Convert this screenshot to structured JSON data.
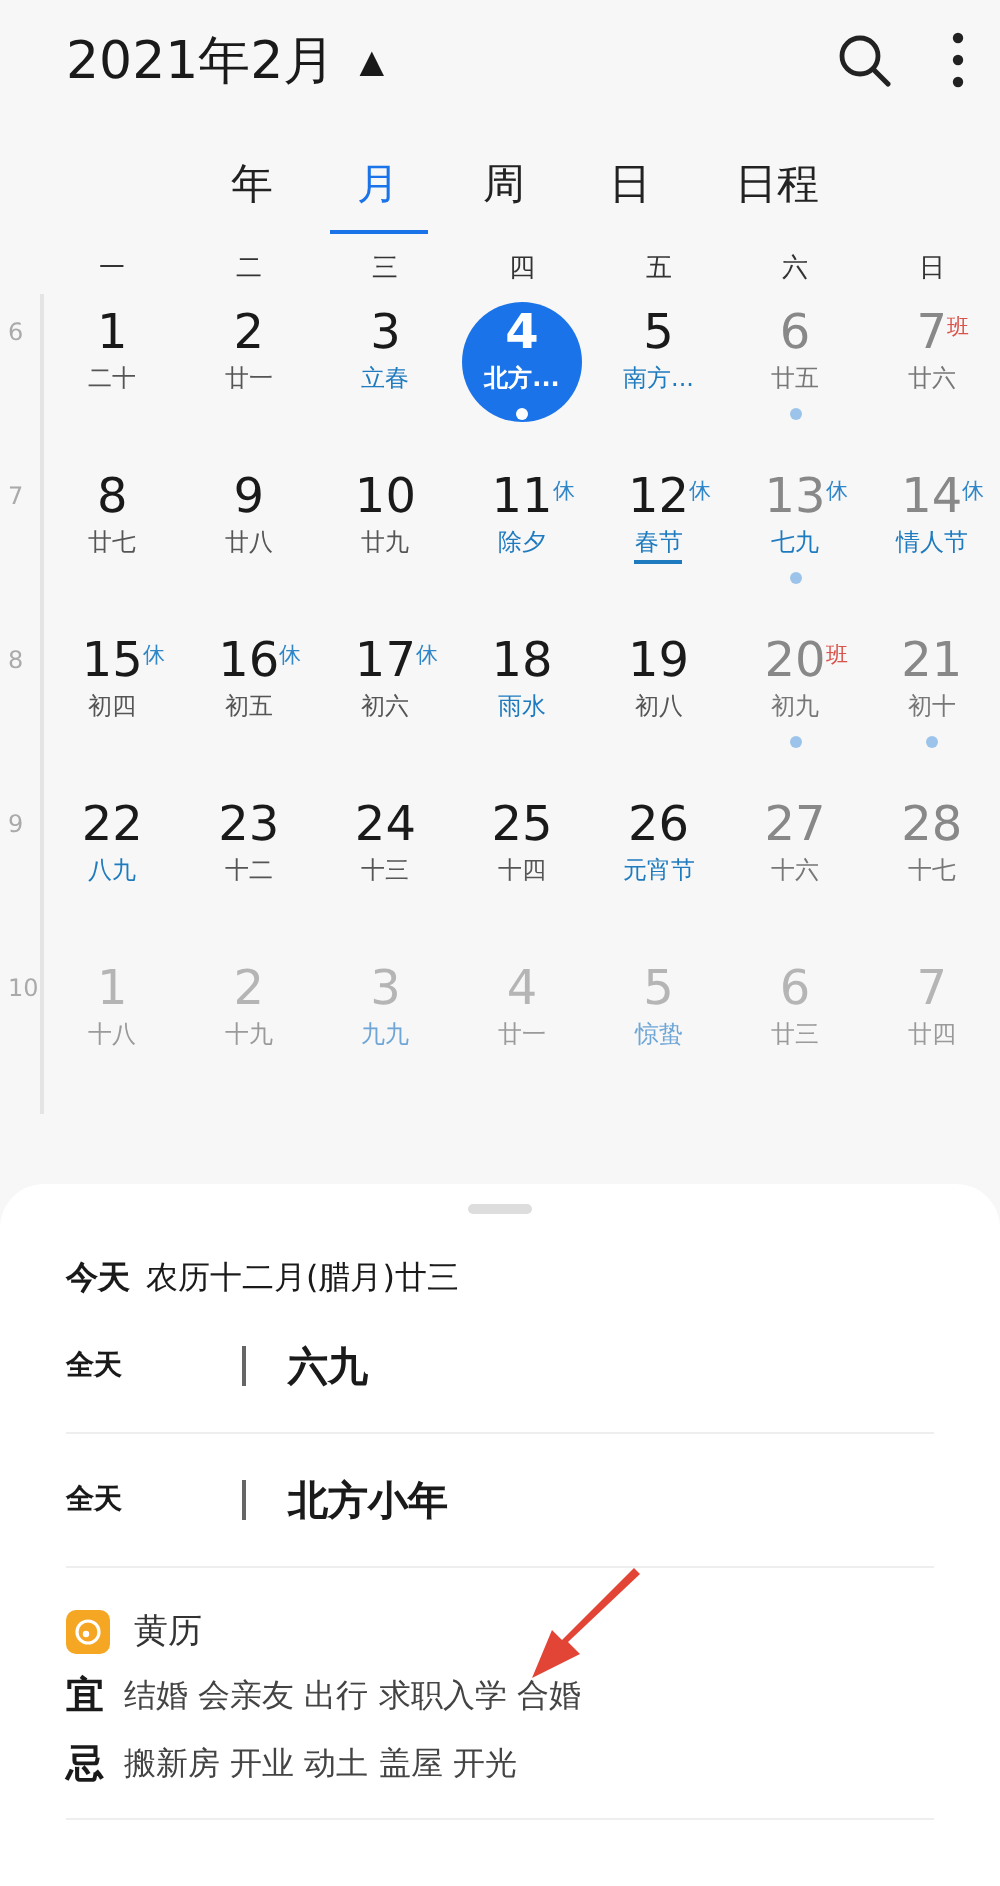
{
  "header": {
    "title": "2021年2月",
    "caret": "▲"
  },
  "view_tabs": [
    {
      "label": "年",
      "selected": false
    },
    {
      "label": "月",
      "selected": true
    },
    {
      "label": "周",
      "selected": false
    },
    {
      "label": "日",
      "selected": false
    },
    {
      "label": "日程",
      "selected": false
    }
  ],
  "weekdays": [
    "一",
    "二",
    "三",
    "四",
    "五",
    "六",
    "日"
  ],
  "weeks": [
    {
      "number": "6",
      "days": [
        {
          "day": "1",
          "lunar": "二十",
          "festival": false,
          "weekend": false,
          "other_month": false,
          "dot": false,
          "selected": false,
          "underlined": false
        },
        {
          "day": "2",
          "lunar": "廿一",
          "festival": false,
          "weekend": false,
          "other_month": false,
          "dot": false,
          "selected": false,
          "underlined": false
        },
        {
          "day": "3",
          "lunar": "立春",
          "festival": true,
          "weekend": false,
          "other_month": false,
          "dot": false,
          "selected": false,
          "underlined": false
        },
        {
          "day": "4",
          "lunar": "北方...",
          "festival": true,
          "weekend": false,
          "other_month": false,
          "dot": true,
          "selected": true,
          "underlined": false
        },
        {
          "day": "5",
          "lunar": "南方...",
          "festival": true,
          "weekend": false,
          "other_month": false,
          "dot": false,
          "selected": false,
          "underlined": false
        },
        {
          "day": "6",
          "lunar": "廿五",
          "festival": false,
          "weekend": true,
          "other_month": false,
          "dot": true,
          "selected": false,
          "underlined": false
        },
        {
          "day": "7",
          "lunar": "廿六",
          "festival": false,
          "weekend": true,
          "other_month": false,
          "dot": false,
          "selected": false,
          "underlined": false,
          "tag": {
            "text": "班",
            "color": "#d9534a"
          }
        }
      ]
    },
    {
      "number": "7",
      "days": [
        {
          "day": "8",
          "lunar": "廿七",
          "festival": false,
          "weekend": false,
          "other_month": false,
          "dot": false,
          "selected": false,
          "underlined": false
        },
        {
          "day": "9",
          "lunar": "廿八",
          "festival": false,
          "weekend": false,
          "other_month": false,
          "dot": false,
          "selected": false,
          "underlined": false
        },
        {
          "day": "10",
          "lunar": "廿九",
          "festival": false,
          "weekend": false,
          "other_month": false,
          "dot": false,
          "selected": false,
          "underlined": false
        },
        {
          "day": "11",
          "lunar": "除夕",
          "festival": true,
          "weekend": false,
          "other_month": false,
          "dot": false,
          "selected": false,
          "underlined": false,
          "tag": {
            "text": "休",
            "color": "#2f86c8"
          }
        },
        {
          "day": "12",
          "lunar": "春节",
          "festival": true,
          "weekend": false,
          "other_month": false,
          "dot": false,
          "selected": false,
          "underlined": true,
          "tag": {
            "text": "休",
            "color": "#2f86c8"
          }
        },
        {
          "day": "13",
          "lunar": "七九",
          "festival": true,
          "weekend": true,
          "other_month": false,
          "dot": true,
          "selected": false,
          "underlined": false,
          "tag": {
            "text": "休",
            "color": "#2f86c8"
          }
        },
        {
          "day": "14",
          "lunar": "情人节",
          "festival": true,
          "weekend": true,
          "other_month": false,
          "dot": false,
          "selected": false,
          "underlined": false,
          "tag": {
            "text": "休",
            "color": "#2f86c8"
          }
        }
      ]
    },
    {
      "number": "8",
      "days": [
        {
          "day": "15",
          "lunar": "初四",
          "festival": false,
          "weekend": false,
          "other_month": false,
          "dot": false,
          "selected": false,
          "underlined": false,
          "tag": {
            "text": "休",
            "color": "#2f86c8"
          }
        },
        {
          "day": "16",
          "lunar": "初五",
          "festival": false,
          "weekend": false,
          "other_month": false,
          "dot": false,
          "selected": false,
          "underlined": false,
          "tag": {
            "text": "休",
            "color": "#2f86c8"
          }
        },
        {
          "day": "17",
          "lunar": "初六",
          "festival": false,
          "weekend": false,
          "other_month": false,
          "dot": false,
          "selected": false,
          "underlined": false,
          "tag": {
            "text": "休",
            "color": "#2f86c8"
          }
        },
        {
          "day": "18",
          "lunar": "雨水",
          "festival": true,
          "weekend": false,
          "other_month": false,
          "dot": false,
          "selected": false,
          "underlined": false
        },
        {
          "day": "19",
          "lunar": "初八",
          "festival": false,
          "weekend": false,
          "other_month": false,
          "dot": false,
          "selected": false,
          "underlined": false
        },
        {
          "day": "20",
          "lunar": "初九",
          "festival": false,
          "weekend": true,
          "other_month": false,
          "dot": true,
          "selected": false,
          "underlined": false,
          "tag": {
            "text": "班",
            "color": "#d9534a"
          }
        },
        {
          "day": "21",
          "lunar": "初十",
          "festival": false,
          "weekend": true,
          "other_month": false,
          "dot": true,
          "selected": false,
          "underlined": false
        }
      ]
    },
    {
      "number": "9",
      "days": [
        {
          "day": "22",
          "lunar": "八九",
          "festival": true,
          "weekend": false,
          "other_month": false,
          "dot": false,
          "selected": false,
          "underlined": false
        },
        {
          "day": "23",
          "lunar": "十二",
          "festival": false,
          "weekend": false,
          "other_month": false,
          "dot": false,
          "selected": false,
          "underlined": false
        },
        {
          "day": "24",
          "lunar": "十三",
          "festival": false,
          "weekend": false,
          "other_month": false,
          "dot": false,
          "selected": false,
          "underlined": false
        },
        {
          "day": "25",
          "lunar": "十四",
          "festival": false,
          "weekend": false,
          "other_month": false,
          "dot": false,
          "selected": false,
          "underlined": false
        },
        {
          "day": "26",
          "lunar": "元宵节",
          "festival": true,
          "weekend": false,
          "other_month": false,
          "dot": false,
          "selected": false,
          "underlined": false
        },
        {
          "day": "27",
          "lunar": "十六",
          "festival": false,
          "weekend": true,
          "other_month": false,
          "dot": false,
          "selected": false,
          "underlined": false
        },
        {
          "day": "28",
          "lunar": "十七",
          "festival": false,
          "weekend": true,
          "other_month": false,
          "dot": false,
          "selected": false,
          "underlined": false
        }
      ]
    },
    {
      "number": "10",
      "days": [
        {
          "day": "1",
          "lunar": "十八",
          "festival": false,
          "other_month": true,
          "dot": false,
          "selected": false,
          "underlined": false
        },
        {
          "day": "2",
          "lunar": "十九",
          "festival": false,
          "other_month": true,
          "dot": false,
          "selected": false,
          "underlined": false
        },
        {
          "day": "3",
          "lunar": "九九",
          "festival": true,
          "other_month": true,
          "dot": false,
          "selected": false,
          "underlined": false
        },
        {
          "day": "4",
          "lunar": "廿一",
          "festival": false,
          "other_month": true,
          "dot": false,
          "selected": false,
          "underlined": false
        },
        {
          "day": "5",
          "lunar": "惊蛰",
          "festival": true,
          "other_month": true,
          "dot": false,
          "selected": false,
          "underlined": false
        },
        {
          "day": "6",
          "lunar": "廿三",
          "festival": false,
          "other_month": true,
          "dot": false,
          "selected": false,
          "underlined": false
        },
        {
          "day": "7",
          "lunar": "廿四",
          "festival": false,
          "other_month": true,
          "dot": false,
          "selected": false,
          "underlined": false
        }
      ]
    }
  ],
  "sheet": {
    "today_label": "今天",
    "lunar_date": "农历十二月(腊月)廿三",
    "events": [
      {
        "time": "全天",
        "title": "六九"
      },
      {
        "time": "全天",
        "title": "北方小年"
      }
    ],
    "almanac": {
      "title": "黄历",
      "lines": [
        {
          "label": "宜",
          "items": "结婚 会亲友 出行 求职入学 合婚"
        },
        {
          "label": "忌",
          "items": "搬新房 开业 动土 盖屋 开光"
        }
      ]
    }
  }
}
